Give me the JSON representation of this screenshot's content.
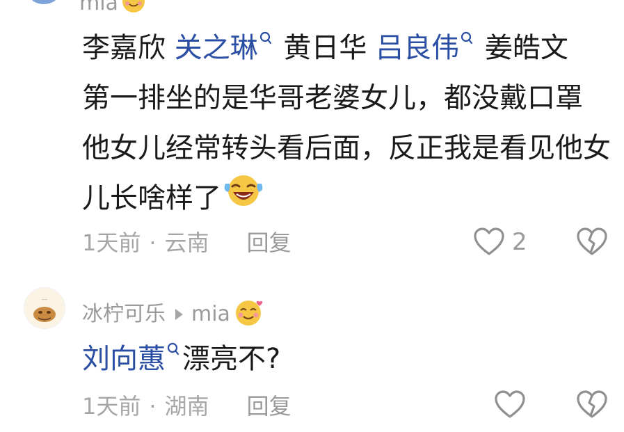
{
  "comment1": {
    "username": "mia",
    "text_segments": [
      {
        "text": "李嘉欣 ",
        "mention": false
      },
      {
        "text": "关之琳",
        "mention": true
      },
      {
        "text": " 黄日华 ",
        "mention": false
      },
      {
        "text": "吕良伟",
        "mention": true
      },
      {
        "text": " 姜皓文　第一排坐的是华哥老婆女儿，都没戴口罩　他女儿经常转头看后面，反正我是看见他女儿长啥样了",
        "mention": false
      }
    ],
    "trailing_emoji": "laughing-crying-emoji",
    "time": "1天前",
    "separator": "·",
    "location": "云南",
    "reply_label": "回复",
    "like_count": "2"
  },
  "comment2": {
    "username": "冰柠可乐",
    "reply_to": "mia",
    "text_segments": [
      {
        "text": "刘向蕙",
        "mention": true
      },
      {
        "text": "漂亮不?",
        "mention": false
      }
    ],
    "time": "1天前",
    "separator": "·",
    "location": "湖南",
    "reply_label": "回复",
    "like_count": ""
  },
  "colors": {
    "mention": "#2a4ea3",
    "body_text": "#1a1a1a",
    "meta_text": "#a6a6a6",
    "icon": "#8f8f8f"
  },
  "icons": [
    "heart-icon",
    "broken-heart-icon",
    "search-icon",
    "blushing-face-emoji",
    "laughing-crying-emoji",
    "reply-arrow-icon"
  ]
}
